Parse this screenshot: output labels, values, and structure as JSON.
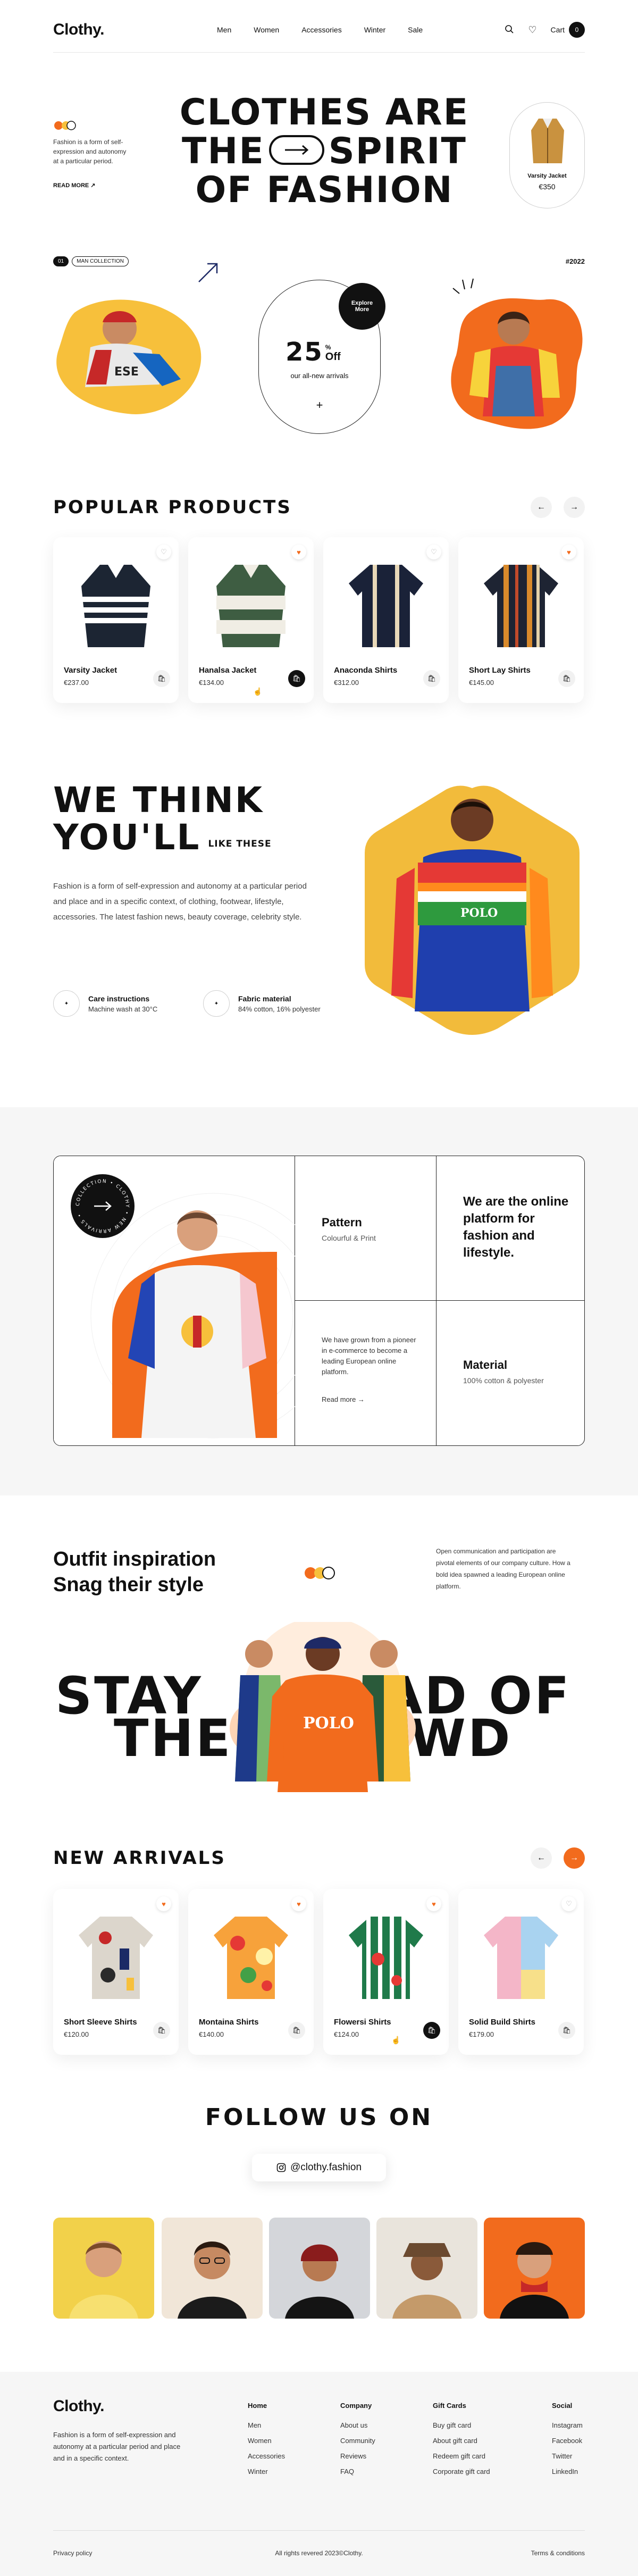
{
  "nav": {
    "logo": "Clothy.",
    "links": [
      "Men",
      "Women",
      "Accessories",
      "Winter",
      "Sale"
    ],
    "cart_label": "Cart",
    "cart_count": "0"
  },
  "hero": {
    "blurb": "Fashion is a form of self-expression and autonomy at a particular period.",
    "read_more": "READ MORE ↗",
    "title_l1": "CLOTHES ARE",
    "title_l2a": "THE",
    "title_l2b": "SPIRIT",
    "title_l3": "OF FASHION",
    "featured": {
      "name": "Varsity Jacket",
      "price": "€350"
    },
    "chip": "MAN COLLECTION",
    "year": "#2022",
    "promo_badge": "Explore More",
    "promo_value": "25",
    "promo_pct": "%",
    "promo_off": "Off",
    "promo_text": "our all-new arrivals",
    "promo_plus": "+"
  },
  "popular": {
    "title": "POPULAR PRODUCTS",
    "products": [
      {
        "name": "Varsity Jacket",
        "price": "€237.00"
      },
      {
        "name": "Hanalsa Jacket",
        "price": "€134.00"
      },
      {
        "name": "Anaconda Shirts",
        "price": "€312.00"
      },
      {
        "name": "Short Lay Shirts",
        "price": "€145.00"
      }
    ]
  },
  "think": {
    "title_l1": "WE THINK",
    "title_l2": "YOU'LL",
    "title_l2b": "LIKE THESE",
    "paragraph": "Fashion is a form of self-expression and autonomy at a particular period and place and in a specific context, of clothing, footwear, lifestyle, accessories. The latest fashion news, beauty coverage, celebrity style.",
    "feature1_title": "Care instructions",
    "feature1_text": "Machine wash at 30°C",
    "feature2_title": "Fabric material",
    "feature2_text": "84% cotton, 16% polyester"
  },
  "grid": {
    "badge_text": "COLLECTION • CLOTHY • NEW ARRIVALS •",
    "pattern_title": "Pattern",
    "pattern_sub": "Colourful & Print",
    "platform_text": "We are the online platform for fashion and lifestyle.",
    "grown_text": "We have grown from a pioneer in e-commerce to become a leading European online platform.",
    "read_more": "Read more →",
    "material_title": "Material",
    "material_sub": "100% cotton & polyester"
  },
  "outfit": {
    "title_l1": "Outfit inspiration",
    "title_l2": "Snag their style",
    "text": "Open communication and participation are pivotal elements of our company culture. How a bold idea spawned a leading European online platform.",
    "stay_l1a": "STAY",
    "stay_l1b": "AD OF",
    "stay_l2a": "THE",
    "stay_l2b": "WD"
  },
  "arrivals": {
    "title": "NEW ARRIVALS",
    "products": [
      {
        "name": "Short Sleeve Shirts",
        "price": "€120.00"
      },
      {
        "name": "Montaina Shirts",
        "price": "€140.00"
      },
      {
        "name": "Flowersi Shirts",
        "price": "€124.00"
      },
      {
        "name": "Solid Build Shirts",
        "price": "€179.00"
      }
    ]
  },
  "follow": {
    "title": "FOLLOW US ON",
    "handle": "@clothy.fashion"
  },
  "footer": {
    "logo": "Clothy.",
    "blurb": "Fashion is a form of self-expression and autonomy at a particular period and place and in a specific context.",
    "col1_title": "Home",
    "col1": [
      "Men",
      "Women",
      "Accessories",
      "Winter"
    ],
    "col2_title": "Company",
    "col2": [
      "About us",
      "Community",
      "Reviews",
      "FAQ"
    ],
    "col3_title": "Gift Cards",
    "col3": [
      "Buy gift card",
      "About gift card",
      "Redeem gift card",
      "Corporate gift card"
    ],
    "col4_title": "Social",
    "col4": [
      "Instagram",
      "Facebook",
      "Twitter",
      "LinkedIn"
    ],
    "privacy": "Privacy policy",
    "copyright": "All rights revered 2023©Clothy.",
    "terms": "Terms & conditions"
  },
  "colors": {
    "accent": "#f26b1d",
    "yellow": "#f7c03b",
    "dark": "#111111"
  }
}
